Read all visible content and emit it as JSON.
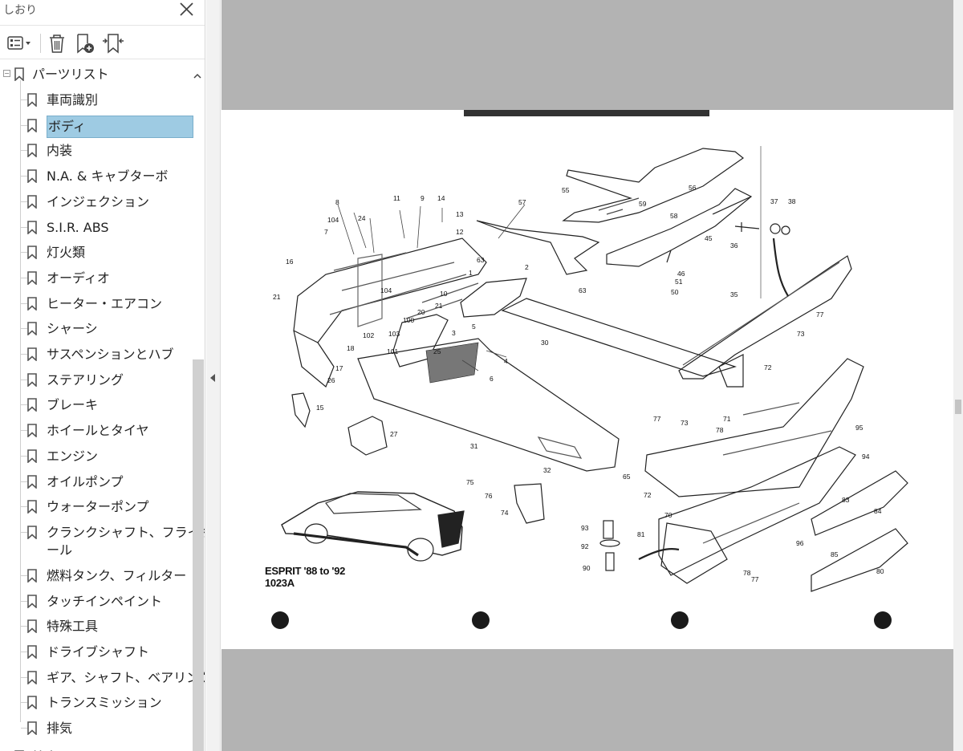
{
  "panel": {
    "title": "しおり",
    "close_icon": "close-icon",
    "toolbar": [
      "options-menu-icon",
      "delete-bookmark-icon",
      "new-bookmark-icon",
      "expand-bookmark-icon"
    ]
  },
  "bookmarks": {
    "root": "パーツリスト",
    "items": [
      {
        "label": "車両識別"
      },
      {
        "label": "ボディ",
        "selected": true
      },
      {
        "label": "内装"
      },
      {
        "label": "N.A. & キャブターボ"
      },
      {
        "label": "インジェクション"
      },
      {
        "label": "S.I.R. ABS"
      },
      {
        "label": "灯火類"
      },
      {
        "label": "オーディオ"
      },
      {
        "label": "ヒーター・エアコン"
      },
      {
        "label": "シャーシ"
      },
      {
        "label": "サスペンションとハブ"
      },
      {
        "label": "ステアリング"
      },
      {
        "label": "ブレーキ"
      },
      {
        "label": "ホイールとタイヤ"
      },
      {
        "label": "エンジン"
      },
      {
        "label": "オイルポンプ"
      },
      {
        "label": "ウォーターポンプ"
      },
      {
        "label": "クランクシャフト、フライホイ",
        "label2": "ール"
      },
      {
        "label": "燃料タンク、フィルター"
      },
      {
        "label": "タッチインペイント"
      },
      {
        "label": "特殊工具"
      },
      {
        "label": "ドライブシャフト"
      },
      {
        "label": "ギア、シャフト、ベアリング"
      },
      {
        "label": "トランスミッション"
      },
      {
        "label": "排気"
      }
    ],
    "next_root": "検索"
  },
  "document": {
    "caption_line1": "ESPRIT '88 to '92",
    "caption_line2": "1023A",
    "part_numbers": [
      "8",
      "104",
      "24",
      "11",
      "9",
      "14",
      "13",
      "12",
      "57",
      "55",
      "56",
      "59",
      "58",
      "37",
      "38",
      "36",
      "45",
      "7",
      "1",
      "63",
      "2",
      "46",
      "51",
      "50",
      "16",
      "21",
      "104",
      "10",
      "21",
      "20",
      "100",
      "63",
      "35",
      "102",
      "103",
      "101",
      "18",
      "3",
      "5",
      "25",
      "30",
      "77",
      "73",
      "72",
      "4",
      "6",
      "17",
      "26",
      "15",
      "27",
      "31",
      "32",
      "71",
      "95",
      "77",
      "73",
      "78",
      "94",
      "65",
      "75",
      "76",
      "74",
      "72",
      "70",
      "83",
      "84",
      "93",
      "81",
      "96",
      "85",
      "92",
      "90",
      "78",
      "77",
      "80"
    ]
  },
  "colors": {
    "selection": "#9ecbe3",
    "doc_background": "#b3b3b3",
    "page": "#ffffff"
  }
}
